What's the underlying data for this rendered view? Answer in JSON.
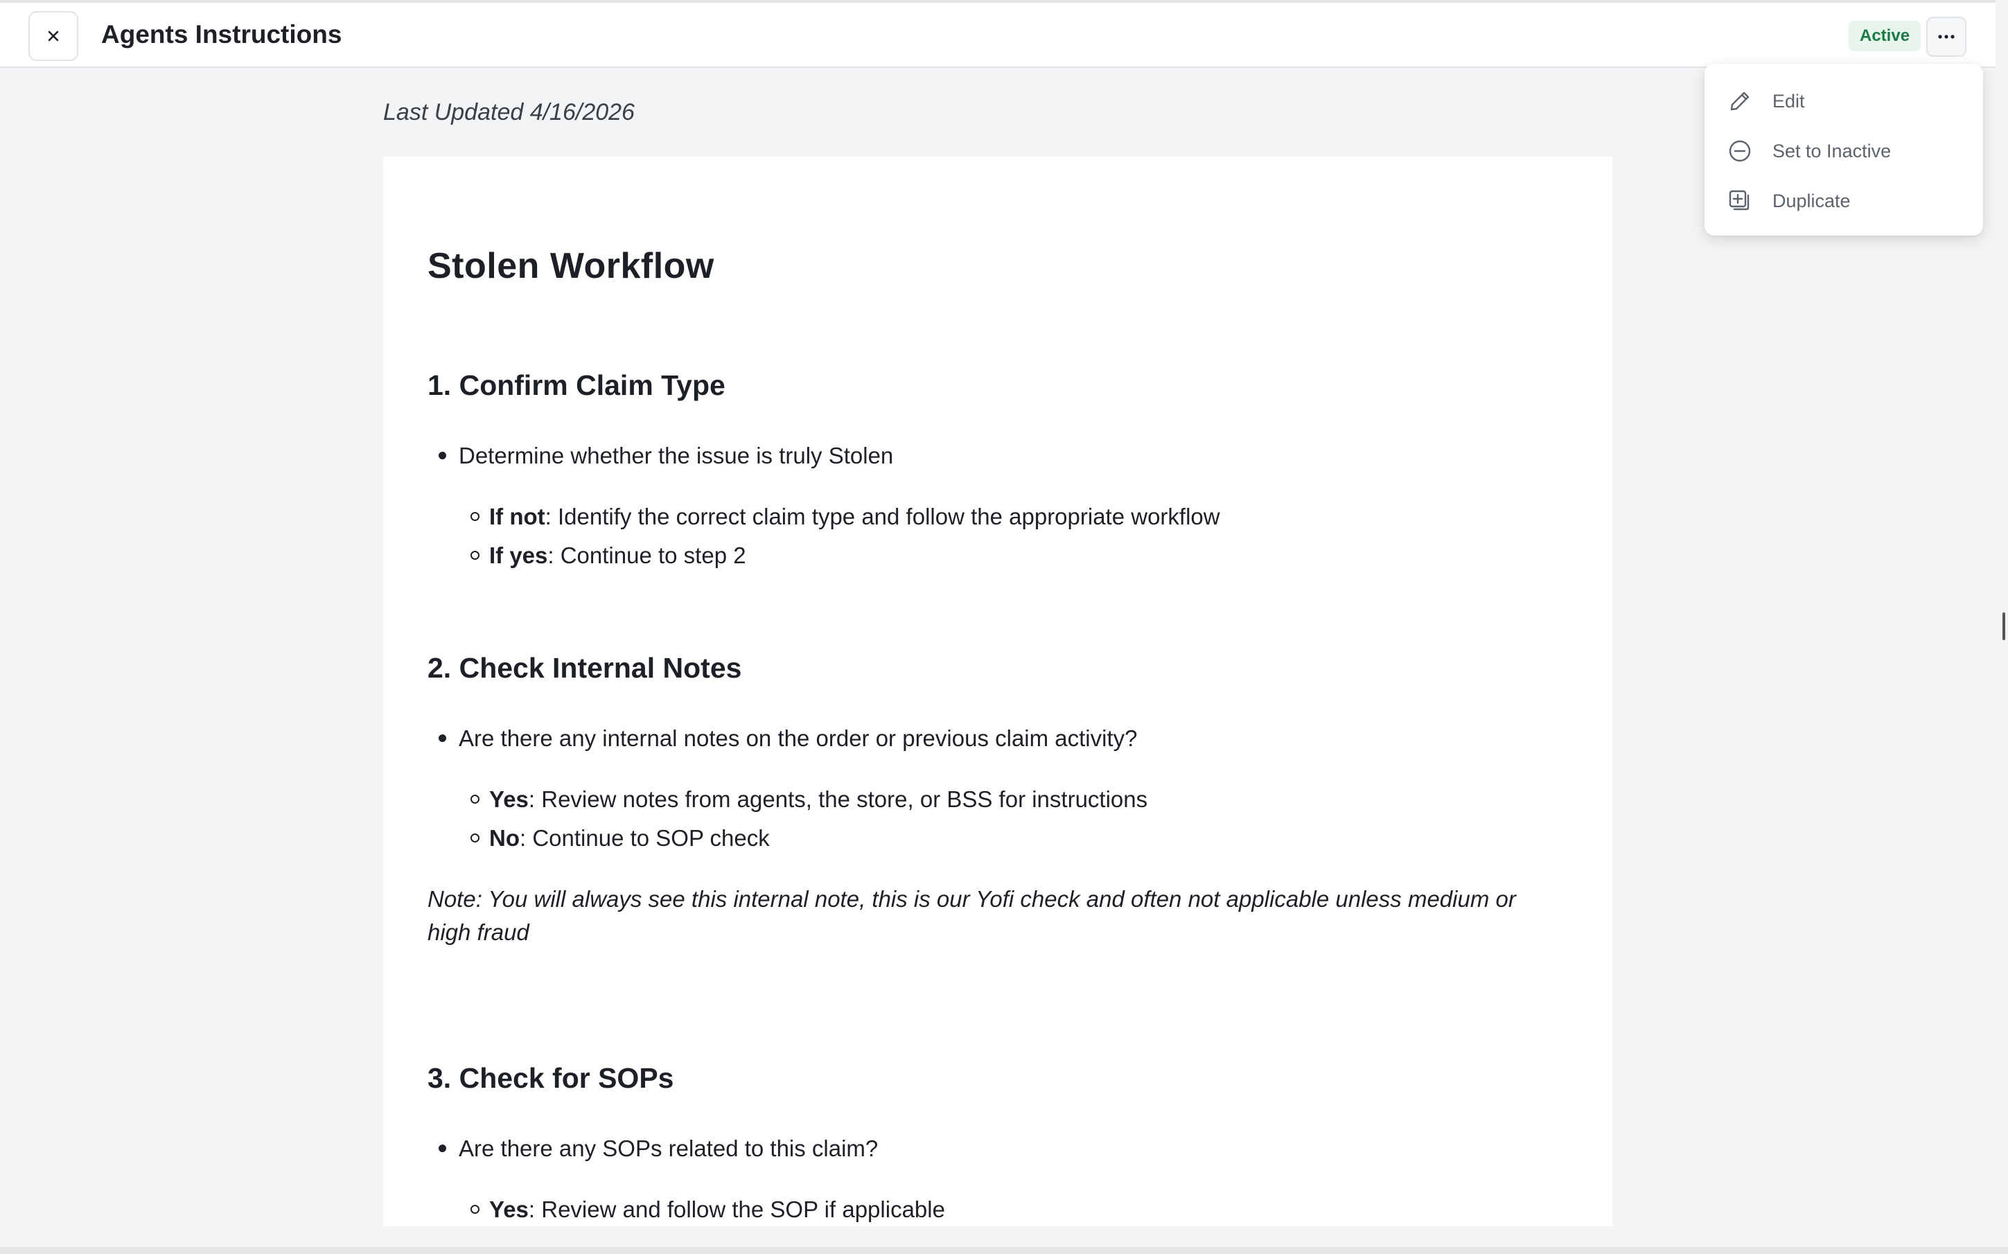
{
  "header": {
    "title": "Agents Instructions",
    "status": "Active",
    "close_icon": "close-icon",
    "more_icon": "more-horizontal-icon"
  },
  "menu": {
    "items": [
      {
        "label": "Edit",
        "icon": "pencil-icon"
      },
      {
        "label": "Set to Inactive",
        "icon": "minus-circle-icon"
      },
      {
        "label": "Duplicate",
        "icon": "duplicate-icon"
      }
    ]
  },
  "last_updated": "Last Updated 4/16/2026",
  "document": {
    "title": "Stolen Workflow",
    "sections": [
      {
        "heading": "1. Confirm Claim Type",
        "bullet": "Determine whether the issue is truly Stolen",
        "subs": [
          {
            "bold": "If not",
            "text": ": Identify the correct claim type and follow the appropriate workflow"
          },
          {
            "bold": "If yes",
            "text": ": Continue to step 2"
          }
        ]
      },
      {
        "heading": "2. Check Internal Notes",
        "bullet": "Are there any internal notes on the order or previous claim activity?",
        "subs": [
          {
            "bold": "Yes",
            "text": ": Review notes from agents, the store, or BSS for instructions"
          },
          {
            "bold": "No",
            "text": ": Continue to SOP check"
          }
        ],
        "note": "Note: You will always see this internal note, this is our Yofi check and often not applicable unless medium or high fraud"
      },
      {
        "heading": "3. Check for SOPs",
        "bullet": "Are there any SOPs related to this claim?",
        "subs": [
          {
            "bold": "Yes",
            "text": ": Review and follow the SOP if applicable"
          }
        ]
      }
    ]
  },
  "colors": {
    "badge_bg": "#e8f5ec",
    "badge_text": "#1e7a45",
    "page_bg": "#f3f4f5"
  }
}
